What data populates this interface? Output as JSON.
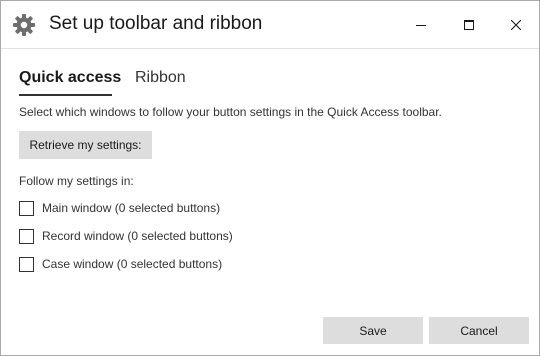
{
  "window": {
    "title": "Set up toolbar and ribbon",
    "title_icon": "gear-icon",
    "controls": [
      "minimize-icon",
      "maximize-icon",
      "close-icon"
    ]
  },
  "tabs": [
    {
      "label": "Quick access",
      "active": true
    },
    {
      "label": "Ribbon",
      "active": false
    }
  ],
  "quick_access": {
    "description": "Select which windows to follow your button settings in the Quick Access toolbar.",
    "retrieve_button": "Retrieve my settings:",
    "follow_label": "Follow my settings in:",
    "options": [
      {
        "label": "Main window (0 selected buttons)",
        "checked": false
      },
      {
        "label": "Record window (0 selected buttons)",
        "checked": false
      },
      {
        "label": "Case window (0 selected buttons)",
        "checked": false
      }
    ]
  },
  "footer": {
    "save_label": "Save",
    "cancel_label": "Cancel"
  },
  "colors": {
    "button_bg": "#dddddd",
    "text": "#333333",
    "icon_gray": "#6e6e6e"
  }
}
